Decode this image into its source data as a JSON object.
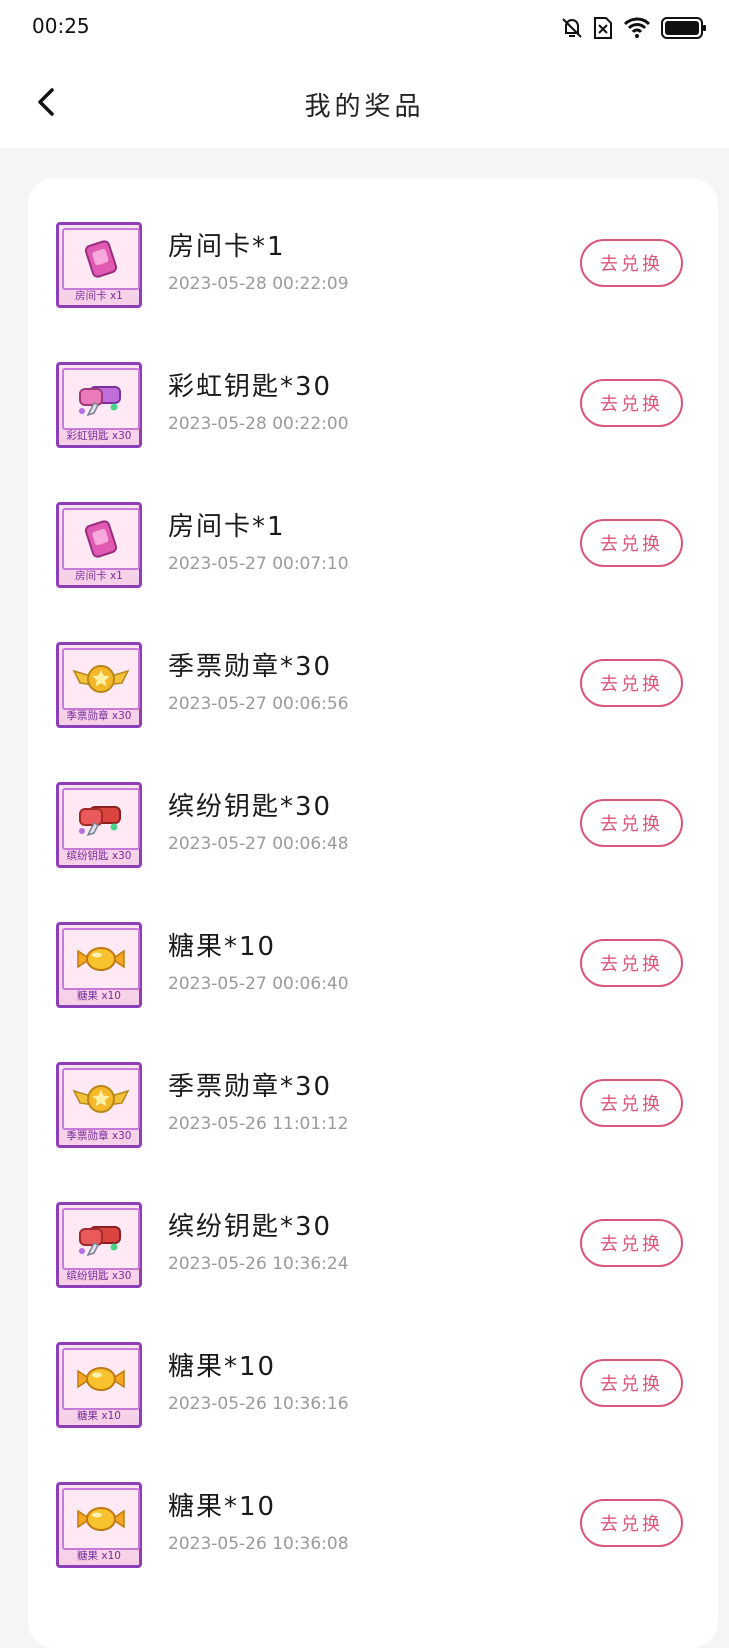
{
  "status_bar": {
    "time": "00:25",
    "icons": [
      "notification-off-icon",
      "no-sim-icon",
      "wifi-icon",
      "battery-icon"
    ]
  },
  "header": {
    "title": "我的奖品",
    "back_icon": "chevron-left-icon"
  },
  "colors": {
    "accent": "#d9577b",
    "thumb_border": "#8e3fb8"
  },
  "prizes": [
    {
      "name": "房间卡*1",
      "time": "2023-05-28 00:22:09",
      "badge": "房间卡 x1",
      "icon": "room-card-icon",
      "action": "去兑换"
    },
    {
      "name": "彩虹钥匙*30",
      "time": "2023-05-28 00:22:00",
      "badge": "彩虹钥匙 x30",
      "icon": "rainbow-key-icon",
      "action": "去兑换"
    },
    {
      "name": "房间卡*1",
      "time": "2023-05-27 00:07:10",
      "badge": "房间卡 x1",
      "icon": "room-card-icon",
      "action": "去兑换"
    },
    {
      "name": "季票勋章*30",
      "time": "2023-05-27 00:06:56",
      "badge": "季票勋章 x30",
      "icon": "season-medal-icon",
      "action": "去兑换"
    },
    {
      "name": "缤纷钥匙*30",
      "time": "2023-05-27 00:06:48",
      "badge": "缤纷钥匙 x30",
      "icon": "colorful-key-icon",
      "action": "去兑换"
    },
    {
      "name": "糖果*10",
      "time": "2023-05-27 00:06:40",
      "badge": "糖果 x10",
      "icon": "candy-icon",
      "action": "去兑换"
    },
    {
      "name": "季票勋章*30",
      "time": "2023-05-26 11:01:12",
      "badge": "季票勋章 x30",
      "icon": "season-medal-icon",
      "action": "去兑换"
    },
    {
      "name": "缤纷钥匙*30",
      "time": "2023-05-26 10:36:24",
      "badge": "缤纷钥匙 x30",
      "icon": "colorful-key-icon",
      "action": "去兑换"
    },
    {
      "name": "糖果*10",
      "time": "2023-05-26 10:36:16",
      "badge": "糖果 x10",
      "icon": "candy-icon",
      "action": "去兑换"
    },
    {
      "name": "糖果*10",
      "time": "2023-05-26 10:36:08",
      "badge": "糖果 x10",
      "icon": "candy-icon",
      "action": "去兑换"
    }
  ]
}
